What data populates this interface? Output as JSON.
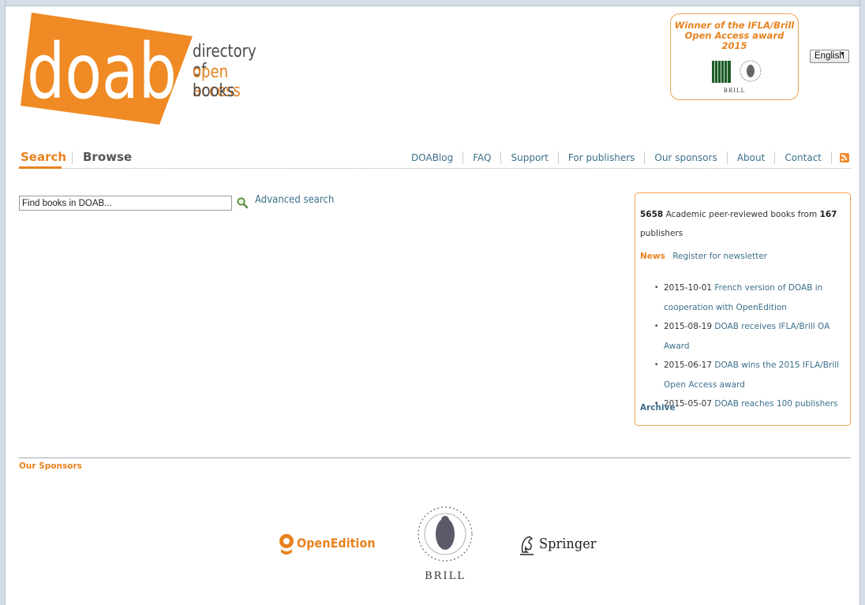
{
  "header": {
    "logo_word": "doab",
    "tagline": [
      "directory of",
      "open access",
      "books"
    ],
    "award": {
      "line1": "Winner of the IFLA/Brill",
      "line2": "Open Access award 2015",
      "brill_text": "BRILL"
    },
    "language": "English"
  },
  "nav": {
    "main_tabs": [
      "Search",
      "Browse"
    ],
    "links": [
      "DOABlog",
      "FAQ",
      "Support",
      "For publishers",
      "Our sponsors",
      "About",
      "Contact"
    ]
  },
  "search": {
    "placeholder": "Find books in DOAB...",
    "advanced": "Advanced search"
  },
  "info": {
    "book_count": "5658",
    "stats_text1": "Academic peer-reviewed books from",
    "publisher_count": "167",
    "stats_text2": "publishers",
    "news_label": "News",
    "register": "Register for newsletter",
    "news": [
      {
        "date": "2015-10-01",
        "title": "French version of DOAB in cooperation with OpenEdition"
      },
      {
        "date": "2015-08-19",
        "title": "DOAB receives IFLA/Brill OA Award"
      },
      {
        "date": "2015-06-17",
        "title": "DOAB wins the 2015 IFLA/Brill Open Access award"
      },
      {
        "date": "2015-05-07",
        "title": "DOAB reaches 100 publishers"
      }
    ],
    "archive": "Archive"
  },
  "sponsors": {
    "title": "Our Sponsors",
    "names": [
      "OpenEdition",
      "BRILL",
      "Springer"
    ]
  },
  "colors": {
    "brand_orange": "#e8821e",
    "link_blue": "#3d6f8c"
  }
}
